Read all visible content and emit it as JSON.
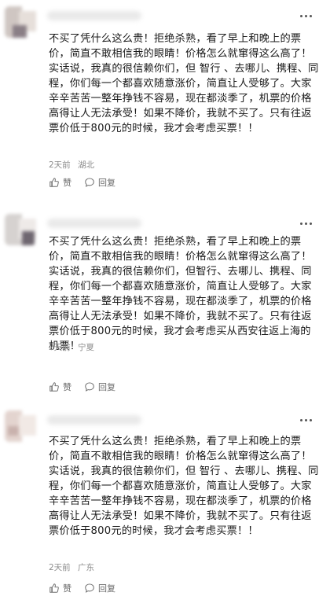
{
  "comments": [
    {
      "text": "不买了凭什么这么贵！拒绝杀熟，看了早上和晚上的票价，简直不敢相信我的眼睛！价格怎么就窜得这么高了！实话说，我真的很信赖你们，但 智行 、去哪儿、携程、同程，你们每一个都喜欢随意涨价，简直让人受够了。大家辛辛苦苦一整年挣钱不容易，现在都淡季了，机票的价格高得让人无法承受！如果不降价，我就不买了。只有往返票价低于800元的时候，我才会考虑买票！！",
      "time": "2天前",
      "location": "湖北",
      "like_label": "赞",
      "reply_label": "回复"
    },
    {
      "text": "不买了凭什么这么贵！拒绝杀熟，看了早上和晚上的票价，简直不敢相信我的眼睛！价格怎么就窜得这么高了！实话说，我真的很信赖你们，但智行、去哪儿、携程、同程，你们每一个都喜欢随意涨价，简直让人受够了。大家辛辛苦苦一整年挣钱不容易，现在都淡季了，机票的价格高得让人无法承受！如果不降价，我就不买了。只有往返票价低于800元的时候，我才会考虑买从西安往返上海的机票！",
      "time": "2天前",
      "location": "宁夏",
      "like_label": "赞",
      "reply_label": "回复"
    },
    {
      "text": "不买了凭什么这么贵！拒绝杀熟，看了早上和晚上的票价，简直不敢相信我的眼睛！价格怎么就窜得这么高了！实话说，我真的很信赖你们，但 智行 、去哪儿、携程、同程，你们每一个都喜欢随意涨价，简直让人受够了。大家辛辛苦苦一整年挣钱不容易，现在都淡季了，机票的价格高得让人无法承受！如果不降价，我就不买了。只有往返票价低于800元的时候，我才会考虑买票！！",
      "time": "2天前",
      "location": "广东",
      "like_label": "赞",
      "reply_label": "回复"
    }
  ]
}
